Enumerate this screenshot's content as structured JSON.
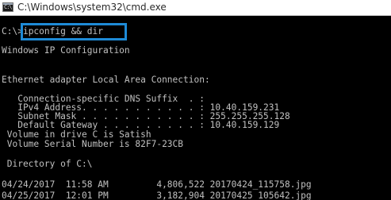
{
  "window": {
    "title": "C:\\Windows\\system32\\cmd.exe",
    "icon": "cmd-icon",
    "icon_glyph": "C:\\"
  },
  "console": {
    "prompt": "C:\\>",
    "command": "ipconfig && dir",
    "highlight_color": "#1e8ad6",
    "lines": [
      "Windows IP Configuration",
      "",
      "",
      "Ethernet adapter Local Area Connection:",
      "",
      "   Connection-specific DNS Suffix  . :",
      "   IPv4 Address. . . . . . . . . . . : 10.40.159.231",
      "   Subnet Mask . . . . . . . . . . . : 255.255.255.128",
      "   Default Gateway . . . . . . . . . : 10.40.159.129",
      " Volume in drive C is Satish",
      " Volume Serial Number is 82F7-23CB",
      "",
      " Directory of C:\\",
      "",
      "04/24/2017  11:58 AM         4,806,522 20170424_115758.jpg",
      "04/25/2017  12:01 PM         3,182,904 20170425_105642.jpg"
    ]
  }
}
